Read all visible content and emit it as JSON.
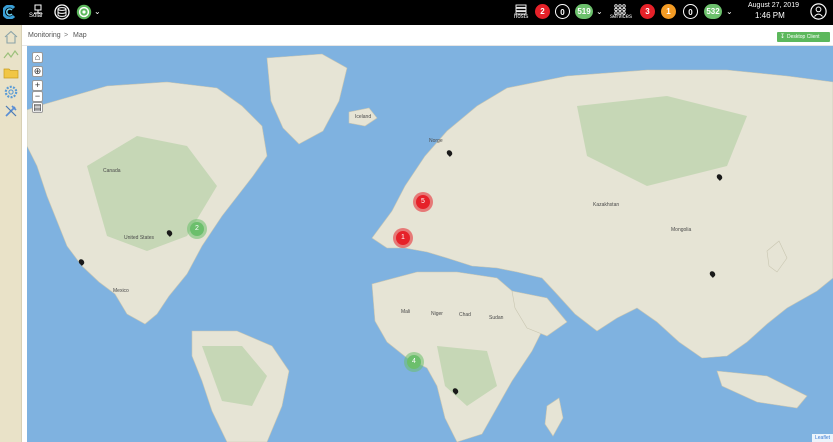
{
  "topbar": {
    "solar_label": "Solar",
    "hosts_label": "hosts",
    "services_label": "services",
    "hosts_counts": [
      {
        "value": "2",
        "color": "#e62129"
      },
      {
        "value": "0",
        "color": "#000000"
      },
      {
        "value": "519",
        "color": "#6cc06c"
      }
    ],
    "services_counts": [
      {
        "value": "3",
        "color": "#e62129"
      },
      {
        "value": "1",
        "color": "#f39b24"
      },
      {
        "value": "0",
        "color": "#000000"
      },
      {
        "value": "532",
        "color": "#6cc06c"
      }
    ],
    "date": "August 27, 2019",
    "time": "1:46 PM"
  },
  "sidebar": {
    "items": [
      {
        "icon": "home-icon"
      },
      {
        "icon": "chart-icon"
      },
      {
        "icon": "folder-icon"
      },
      {
        "icon": "gear-icon"
      },
      {
        "icon": "tools-icon"
      }
    ]
  },
  "breadcrumb": {
    "root": "Monitoring",
    "separator": ">",
    "current": "Map"
  },
  "actions": {
    "desktop_client": "Desktop Client"
  },
  "map": {
    "attribution": "Leaflet",
    "clusters": [
      {
        "count": "2",
        "color": "#6cbf6c"
      },
      {
        "count": "5",
        "color": "#e62129"
      },
      {
        "count": "1",
        "color": "#e62129"
      },
      {
        "count": "4",
        "color": "#6cbf6c"
      }
    ],
    "labels": [
      "Iceland",
      "Norge",
      "United States",
      "Mexico",
      "Mali",
      "Niger",
      "Chad",
      "Sudan",
      "Kazakhstan",
      "Mongolia",
      "Canada"
    ]
  }
}
